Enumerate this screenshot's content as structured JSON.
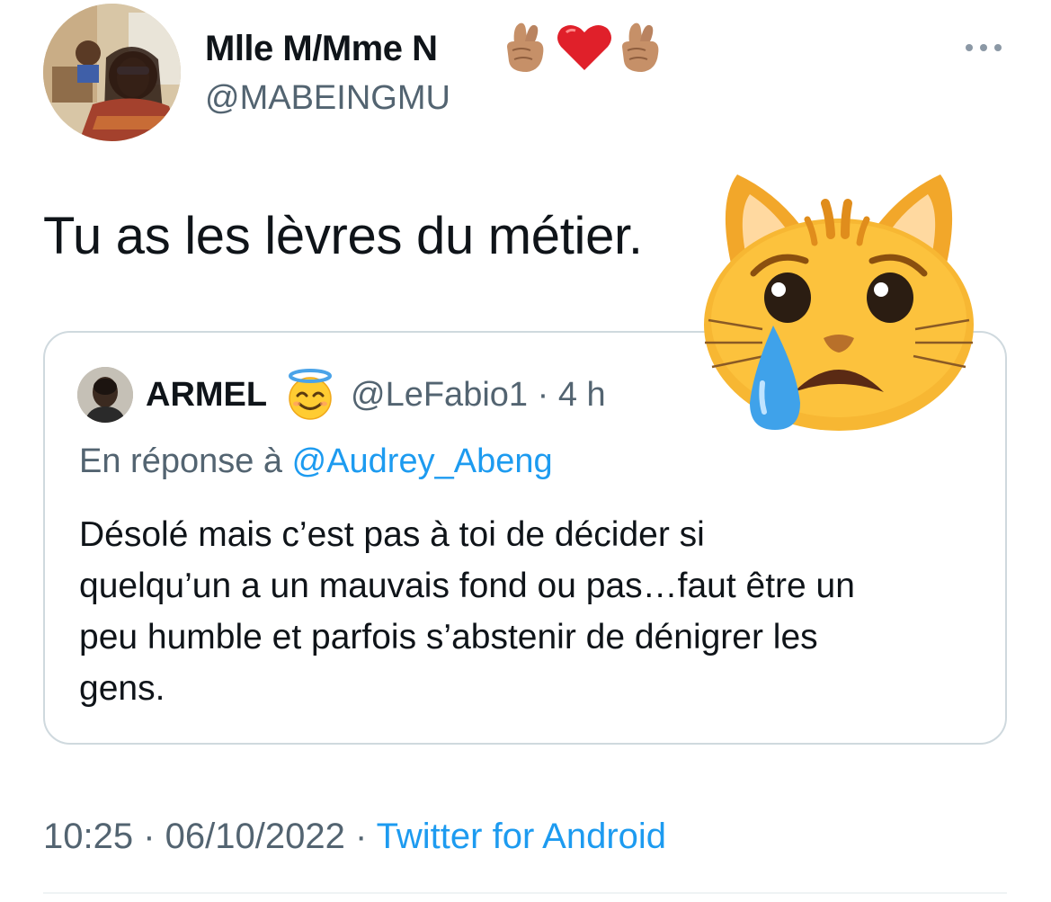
{
  "tweet": {
    "author": {
      "display_name": "Mlle M/Mme N",
      "name_emojis": [
        "crossed-fingers",
        "red-heart",
        "crossed-fingers"
      ],
      "handle": "@MABEINGMU"
    },
    "text": "Tu as les lèvres du métier.",
    "reaction_emoji": "crying-cat-face",
    "timestamp": "10:25 · 06/10/2022",
    "separator": " · ",
    "source": "Twitter for Android"
  },
  "quoted_tweet": {
    "author": {
      "display_name": "ARMEL",
      "name_emoji": "smiling-face-with-halo",
      "handle": "@LeFabio1",
      "time": "4 h"
    },
    "meta_separator": " · ",
    "reply_prefix": "En réponse à ",
    "reply_to": "@Audrey_Abeng",
    "text_lines": [
      "Désolé mais c’est pas à toi de décider si",
      "quelqu’un a un mauvais fond ou pas…faut être un",
      "peu humble et parfois s’abstenir de dénigrer les",
      "gens."
    ]
  },
  "colors": {
    "text_primary": "#0f1419",
    "text_secondary": "#536471",
    "link": "#1d9bf0",
    "border": "#cfd9de"
  }
}
